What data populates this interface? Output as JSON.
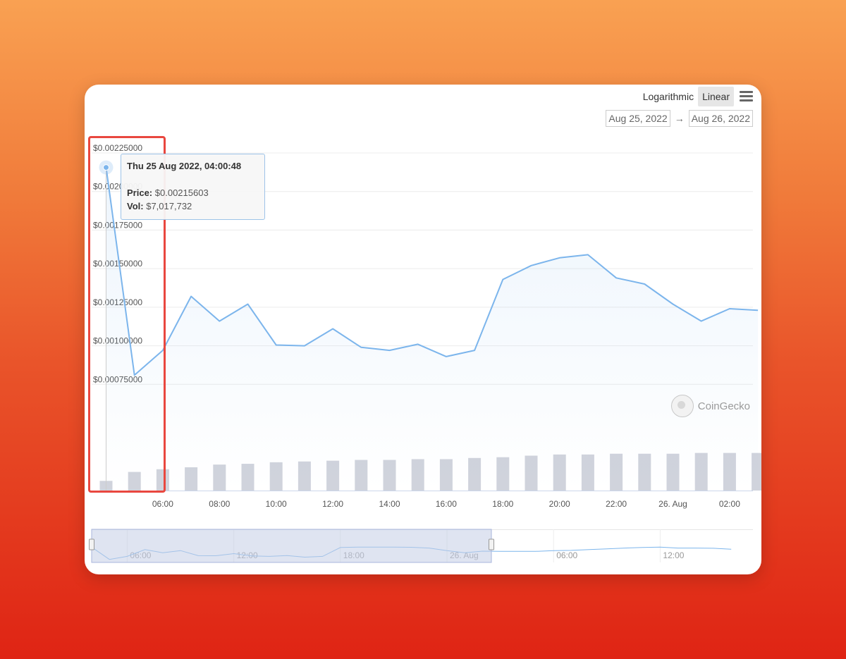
{
  "scale_toggle": {
    "logarithmic_label": "Logarithmic",
    "linear_label": "Linear",
    "active": "Linear"
  },
  "date_range": {
    "from": "Aug 25, 2022",
    "arrow": "→",
    "to": "Aug 26, 2022"
  },
  "tooltip": {
    "date": "Thu 25 Aug 2022, 04:00:48",
    "price_label": "Price:",
    "price_value": "$0.00215603",
    "vol_label": "Vol:",
    "vol_value": "$7,017,732"
  },
  "watermark": "CoinGecko",
  "colors": {
    "line": "#7cb5ec",
    "volume_bar": "#d0d3dc",
    "highlight_box": "#e9473f",
    "navigator_mask": "#c5cde6"
  },
  "chart_data": {
    "type": "line",
    "y_tick_labels": [
      "$0.00225000",
      "$0.00200000",
      "$0.00175000",
      "$0.00150000",
      "$0.00125000",
      "$0.00100000",
      "$0.00075000"
    ],
    "y_ticks": [
      0.00225,
      0.002,
      0.00175,
      0.0015,
      0.00125,
      0.001,
      0.00075
    ],
    "ylim": [
      0.0005,
      0.00225
    ],
    "x_tick_labels": [
      "06:00",
      "08:00",
      "10:00",
      "12:00",
      "14:00",
      "16:00",
      "18:00",
      "20:00",
      "22:00",
      "26. Aug",
      "02:00"
    ],
    "x_ticks": [
      "2022-08-25 06:00",
      "2022-08-25 08:00",
      "2022-08-25 10:00",
      "2022-08-25 12:00",
      "2022-08-25 14:00",
      "2022-08-25 16:00",
      "2022-08-25 18:00",
      "2022-08-25 20:00",
      "2022-08-25 22:00",
      "2022-08-26 00:00",
      "2022-08-26 02:00"
    ],
    "x": [
      "2022-08-25 04:00",
      "2022-08-25 05:00",
      "2022-08-25 06:00",
      "2022-08-25 07:00",
      "2022-08-25 08:00",
      "2022-08-25 09:00",
      "2022-08-25 10:00",
      "2022-08-25 11:00",
      "2022-08-25 12:00",
      "2022-08-25 13:00",
      "2022-08-25 14:00",
      "2022-08-25 15:00",
      "2022-08-25 16:00",
      "2022-08-25 17:00",
      "2022-08-25 18:00",
      "2022-08-25 19:00",
      "2022-08-25 20:00",
      "2022-08-25 21:00",
      "2022-08-25 22:00",
      "2022-08-25 23:00",
      "2022-08-26 00:00",
      "2022-08-26 01:00",
      "2022-08-26 02:00",
      "2022-08-26 03:00"
    ],
    "series": [
      {
        "values": [
          0.00215603,
          0.00081,
          0.00097,
          0.00132,
          0.00116,
          0.00127,
          0.001005,
          0.001,
          0.00111,
          0.00099,
          0.00097,
          0.00101,
          0.00093,
          0.00097,
          0.00143,
          0.00152,
          0.00157,
          0.00159,
          0.00144,
          0.0014,
          0.00127,
          0.00116,
          0.00124,
          0.00123
        ]
      }
    ],
    "volume_relative": [
      0.25,
      0.48,
      0.55,
      0.6,
      0.67,
      0.69,
      0.73,
      0.75,
      0.77,
      0.79,
      0.79,
      0.81,
      0.81,
      0.84,
      0.86,
      0.9,
      0.93,
      0.93,
      0.95,
      0.95,
      0.95,
      0.97,
      0.97,
      0.97
    ],
    "navigator": {
      "x_tick_labels": [
        "06:00",
        "12:00",
        "18:00",
        "26. Aug",
        "06:00",
        "12:00"
      ],
      "selected_range": [
        "2022-08-25 04:00",
        "2022-08-26 03:00"
      ]
    },
    "grid": true,
    "legend": "none"
  }
}
